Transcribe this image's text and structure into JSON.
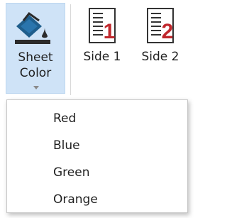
{
  "ribbon": {
    "sheet_color": {
      "label_line1": "Sheet",
      "label_line2": "Color",
      "icon": "paint-bucket-icon",
      "selected_bg": "#cfe3f7"
    },
    "side1": {
      "label": "Side 1",
      "number": "1",
      "icon": "sheet-side-1-icon"
    },
    "side2": {
      "label": "Side 2",
      "number": "2",
      "icon": "sheet-side-2-icon"
    }
  },
  "menu": {
    "items": [
      {
        "label": "Red"
      },
      {
        "label": "Blue"
      },
      {
        "label": "Green"
      },
      {
        "label": "Orange"
      }
    ]
  },
  "colors": {
    "accent_red": "#c0282d",
    "icon_blue": "#1f5e8c",
    "icon_dark": "#333333"
  }
}
